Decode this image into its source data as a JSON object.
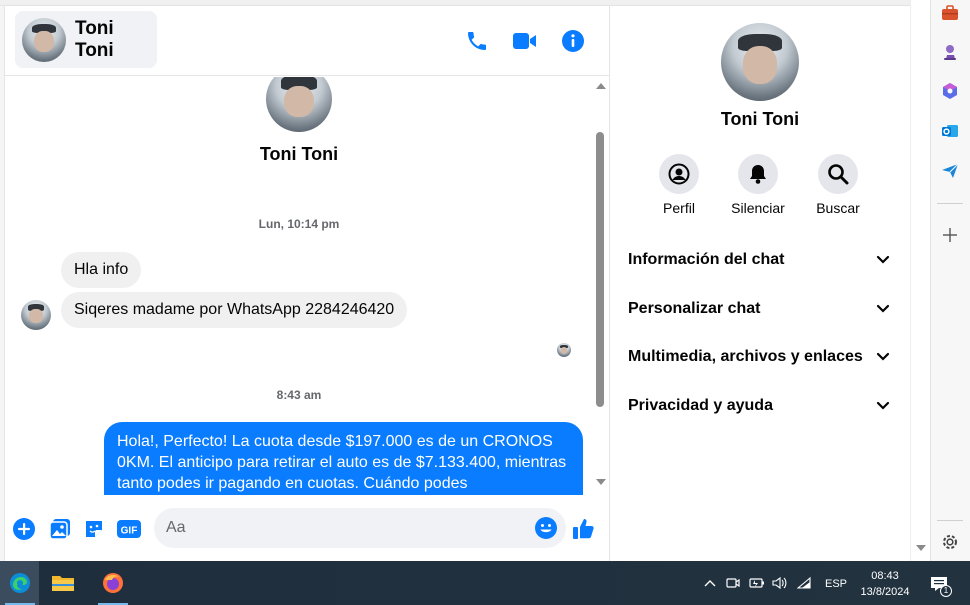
{
  "chat": {
    "contact_name": "Toni Toni",
    "header_actions": {
      "call": "phone-icon",
      "video": "video-icon",
      "info": "info-icon"
    }
  },
  "thread": {
    "profile_name": "Toni Toni",
    "timestamp_1": "Lun, 10:14 pm",
    "incoming": [
      "Hla info",
      "Siqeres madame por WhatsApp 2284246420"
    ],
    "timestamp_2": "8:43 am",
    "outgoing_1": "Hola!, Perfecto! La cuota desde $197.000 es de un CRONOS 0KM. El anticipo para retirar el auto es de $7.133.400, mientras tanto podes ir pagando en cuotas. Cuándo podes"
  },
  "composer": {
    "placeholder": "Aa",
    "icons": [
      "plus-icon",
      "image-icon",
      "sticker-icon",
      "gif-icon",
      "emoji-icon",
      "like-icon"
    ],
    "gif_label": "GIF"
  },
  "info_panel": {
    "name": "Toni Toni",
    "actions": [
      {
        "label": "Perfil",
        "icon": "profile-icon"
      },
      {
        "label": "Silenciar",
        "icon": "bell-icon"
      },
      {
        "label": "Buscar",
        "icon": "search-icon"
      }
    ],
    "sections": [
      "Información del chat",
      "Personalizar chat",
      "Multimedia, archivos y enlaces",
      "Privacidad y ayuda"
    ]
  },
  "taskbar": {
    "language": "ESP",
    "time": "08:43",
    "date": "13/8/2024",
    "notifications": "1"
  },
  "colors": {
    "accent": "#0a7cff",
    "incoming_bubble": "#f0f0f0",
    "taskbar": "#1f2e3d"
  }
}
